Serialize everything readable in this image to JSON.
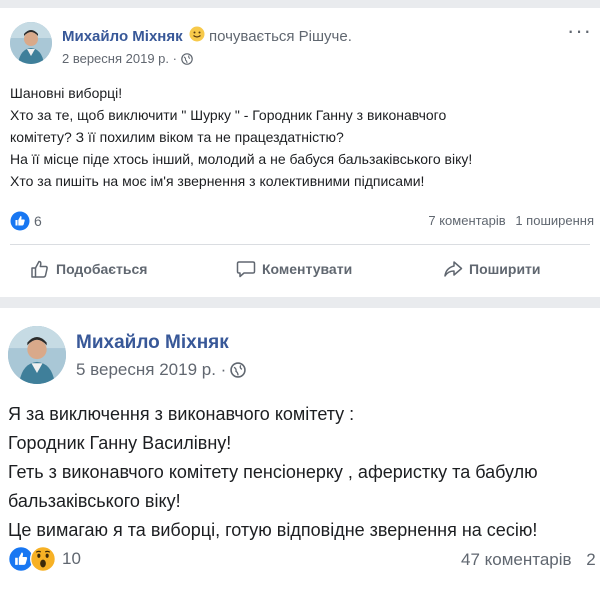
{
  "post1": {
    "author": "Михайло Міхняк",
    "feeling_emoji": "smiling-face-icon",
    "feeling_text": "почувається Рішуче.",
    "date": "2 вересня 2019 р. ·",
    "privacy_icon": "globe-icon",
    "lines": [
      "Шановні виборці!",
      "Хто за те, щоб виключити \" Шурку \" - Городник Ганну з виконавчого",
      "комітету? З її похилим віком та не працездатністю?",
      "На її місце піде хтось інший, молодий а не бабуся бальзаківського віку!",
      "Хто за пишіть на моє ім'я звернення з колективними підписами!"
    ],
    "reaction_count": "6",
    "comments": "7 коментарів",
    "shares": "1 поширення",
    "actions": {
      "like": "Подобається",
      "comment": "Коментувати",
      "share": "Поширити"
    },
    "more_icon": "more-dots-icon"
  },
  "post2": {
    "author": "Михайло Міхняк",
    "date": "5 вересня 2019 р. ·",
    "privacy_icon": "globe-icon",
    "lines": [
      "Я за виключення з виконавчого комітету :",
      "Городник Ганну Василівну!",
      "Геть з виконавчого комітету пенсіонерку , аферистку та бабулю",
      "бальзаківського віку!",
      "Це вимагаю я та виборці, готую відповідне звернення на сесію!"
    ],
    "reaction_count": "10",
    "reaction_icons": [
      "like-icon",
      "wow-icon"
    ],
    "comments": "47 коментарів",
    "shares_partial": "2"
  },
  "colors": {
    "author": "#385898",
    "secondary": "#606770",
    "like_blue": "#1877f2",
    "wow_yellow": "#f7b125",
    "background": "#e9ebee"
  }
}
